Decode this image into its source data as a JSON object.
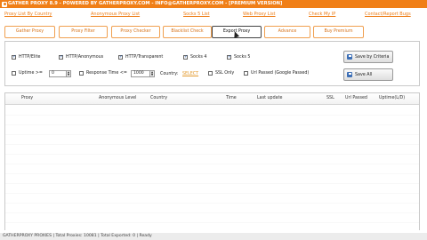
{
  "window": {
    "title": "GATHER PROXY 8.9 - POWERED BY GATHERPROXY.COM - INFO@GATHERPROXY.COM - [PREMIUM VERSION]"
  },
  "links": [
    "Proxy List By Country",
    "Anonymous Proxy List",
    "Socks 5 List",
    "Web Proxy List",
    "Check My IP",
    "Contact/Report Bugs"
  ],
  "tabs": [
    "Gather Proxy",
    "Proxy Filter",
    "Proxy Checker",
    "Blacklist Check",
    "Export Proxy",
    "Advance",
    "Buy Premium"
  ],
  "active_tab": "Export Proxy",
  "filters": {
    "http_elite": "HTTP/Elite",
    "http_anonymous": "HTTP/Anonymous",
    "http_transparent": "HTTP/Transparent",
    "socks4": "Socks 4",
    "socks5": "Socks 5",
    "uptime_label": "Uptime >=",
    "uptime_value": "0",
    "response_time_label": "Response Time <=",
    "response_time_value": "1000",
    "country_label": "Country:",
    "country_value": "SELECT",
    "ssl_only": "SSL Only",
    "url_passed": "Url Passed (Google Passed)"
  },
  "buttons": {
    "save_by_criteria": "Save by Criteria",
    "save_all": "Save All"
  },
  "table": {
    "columns": [
      "Proxy",
      "Anonymous Level",
      "Country",
      "Time",
      "Last update",
      "SSL",
      "Url Passed",
      "Uptime(L/D)"
    ]
  },
  "status": {
    "text": "GATHERPROXY PROXIES | Total Proxies: 10081 | Total Exported: 0 | Ready"
  },
  "colors": {
    "accent": "#f07f17",
    "link": "#ed7d16"
  }
}
